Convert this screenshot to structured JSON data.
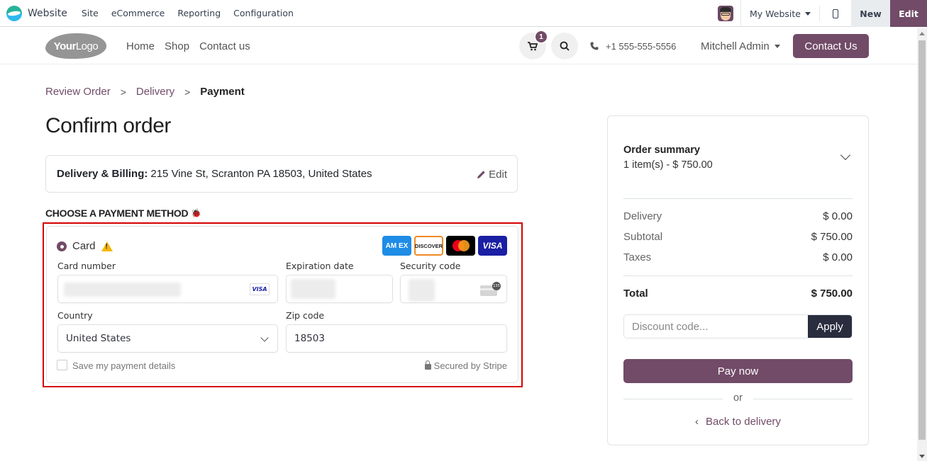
{
  "topbar": {
    "app_name": "Website",
    "menus": [
      "Site",
      "eCommerce",
      "Reporting",
      "Configuration"
    ],
    "website_selector": "My Website",
    "new_label": "New",
    "edit_label": "Edit"
  },
  "header": {
    "logo_bold": "Your",
    "logo_light": "Logo",
    "nav": [
      "Home",
      "Shop",
      "Contact us"
    ],
    "cart_count": "1",
    "phone": "+1 555-555-5556",
    "user": "Mitchell Admin",
    "contact_button": "Contact Us"
  },
  "breadcrumb": {
    "steps": [
      "Review Order",
      "Delivery",
      "Payment"
    ],
    "separator": ">"
  },
  "page_title": "Confirm order",
  "address": {
    "label": "Delivery & Billing:",
    "value": "215 Vine St, Scranton PA 18503, United States",
    "edit_label": "Edit"
  },
  "payment": {
    "heading": "CHOOSE A PAYMENT METHOD",
    "method": "Card",
    "brands": {
      "amex": "AM EX",
      "discover": "DISCOVER",
      "mastercard": "",
      "visa": "VISA"
    },
    "card_number_label": "Card number",
    "card_brand_mini": "VISA",
    "expiration_label": "Expiration date",
    "security_label": "Security code",
    "cvc_hint": "135",
    "country_label": "Country",
    "country_value": "United States",
    "zip_label": "Zip code",
    "zip_value": "18503",
    "save_label": "Save my payment details",
    "secured_label": "Secured by Stripe"
  },
  "summary": {
    "title": "Order summary",
    "subtitle": "1 item(s) -  $ 750.00",
    "rows": [
      {
        "label": "Delivery",
        "value": "$ 0.00"
      },
      {
        "label": "Subtotal",
        "value": "$ 750.00"
      },
      {
        "label": "Taxes",
        "value": "$ 0.00"
      }
    ],
    "total_label": "Total",
    "total_value": "$ 750.00",
    "discount_placeholder": "Discount code...",
    "apply_label": "Apply",
    "pay_label": "Pay now",
    "or_label": "or",
    "back_label": "Back to delivery"
  },
  "colors": {
    "brand": "#714b67",
    "highlight": "#d40000",
    "apply_bg": "#2a2d3e"
  }
}
